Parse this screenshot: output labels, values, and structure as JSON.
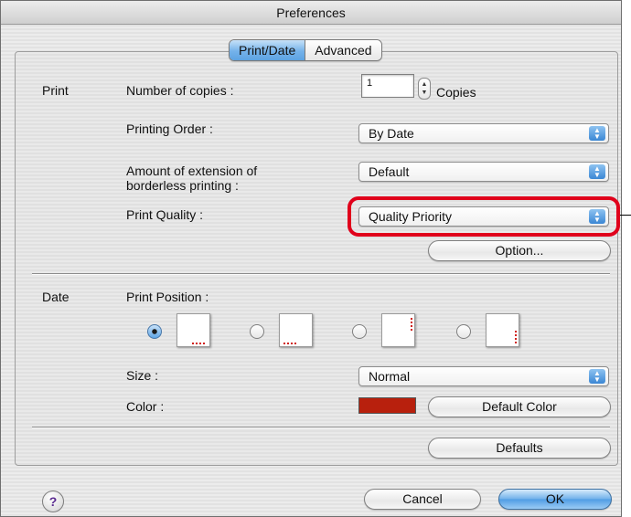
{
  "window": {
    "title": "Preferences"
  },
  "tabs": [
    {
      "label": "Print/Date",
      "active": true
    },
    {
      "label": "Advanced",
      "active": false
    }
  ],
  "print": {
    "section_label": "Print",
    "copies_label": "Number of copies :",
    "copies_value": "1",
    "copies_unit": "Copies",
    "order_label": "Printing Order :",
    "order_value": "By Date",
    "extension_label_line1": "Amount of extension of",
    "extension_label_line2": "borderless printing :",
    "extension_value": "Default",
    "quality_label": "Print Quality :",
    "quality_value": "Quality Priority",
    "option_button": "Option..."
  },
  "date": {
    "section_label": "Date",
    "position_label": "Print Position :",
    "positions": [
      {
        "name": "bottom-right-horizontal",
        "selected": true
      },
      {
        "name": "bottom-left-horizontal",
        "selected": false
      },
      {
        "name": "top-right-vertical",
        "selected": false
      },
      {
        "name": "bottom-right-vertical",
        "selected": false
      }
    ],
    "size_label": "Size :",
    "size_value": "Normal",
    "color_label": "Color :",
    "color_value": "#b8200d",
    "default_color_button": "Default Color"
  },
  "buttons": {
    "defaults": "Defaults",
    "cancel": "Cancel",
    "ok": "OK",
    "help": "?"
  },
  "colors": {
    "accent": "#5da3e2",
    "highlight": "#e0001b",
    "date_mark": "#d0201a"
  },
  "icons": {
    "help": "help-icon",
    "popup_arrows": "updown-arrows-icon",
    "stepper": "stepper-arrows-icon"
  }
}
